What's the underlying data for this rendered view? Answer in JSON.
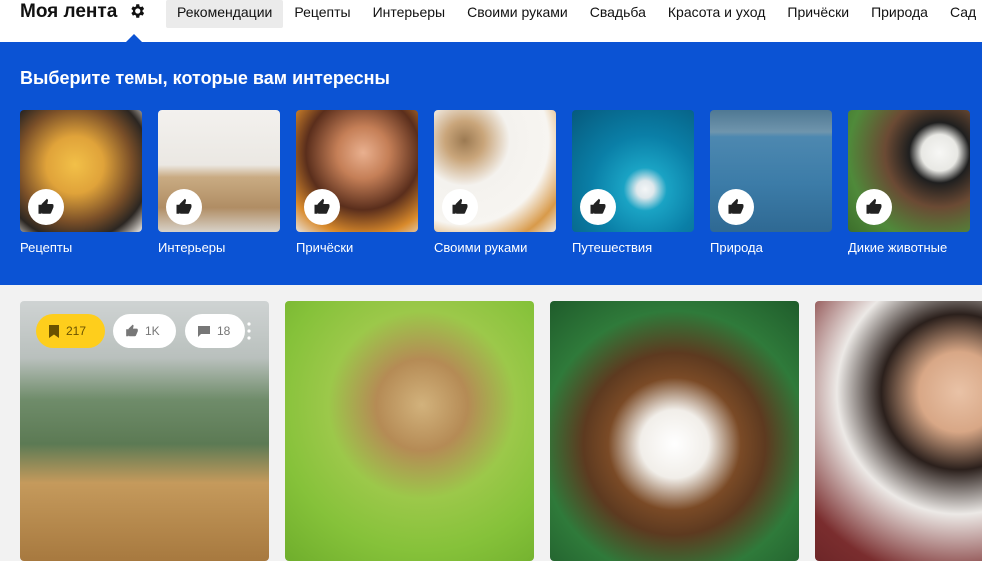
{
  "header": {
    "title": "Моя лента",
    "nav": [
      "Рекомендации",
      "Рецепты",
      "Интерьеры",
      "Своими руками",
      "Свадьба",
      "Красота и уход",
      "Причёски",
      "Природа",
      "Сад"
    ]
  },
  "topics": {
    "heading": "Выберите темы, которые вам интересны",
    "items": [
      {
        "label": "Рецепты",
        "icon": "thumbs-up-icon"
      },
      {
        "label": "Интерьеры",
        "icon": "thumbs-up-icon"
      },
      {
        "label": "Причёски",
        "icon": "thumbs-up-icon"
      },
      {
        "label": "Своими руками",
        "icon": "thumbs-up-icon"
      },
      {
        "label": "Путешествия",
        "icon": "thumbs-up-icon"
      },
      {
        "label": "Природа",
        "icon": "thumbs-up-icon"
      },
      {
        "label": "Дикие животные",
        "icon": "thumbs-up-icon"
      }
    ]
  },
  "cards": [
    {
      "saves": "217",
      "likes": "1K",
      "comments": "18"
    }
  ],
  "colors": {
    "accent": "#0b53d4",
    "saves_badge": "#fece1c"
  }
}
